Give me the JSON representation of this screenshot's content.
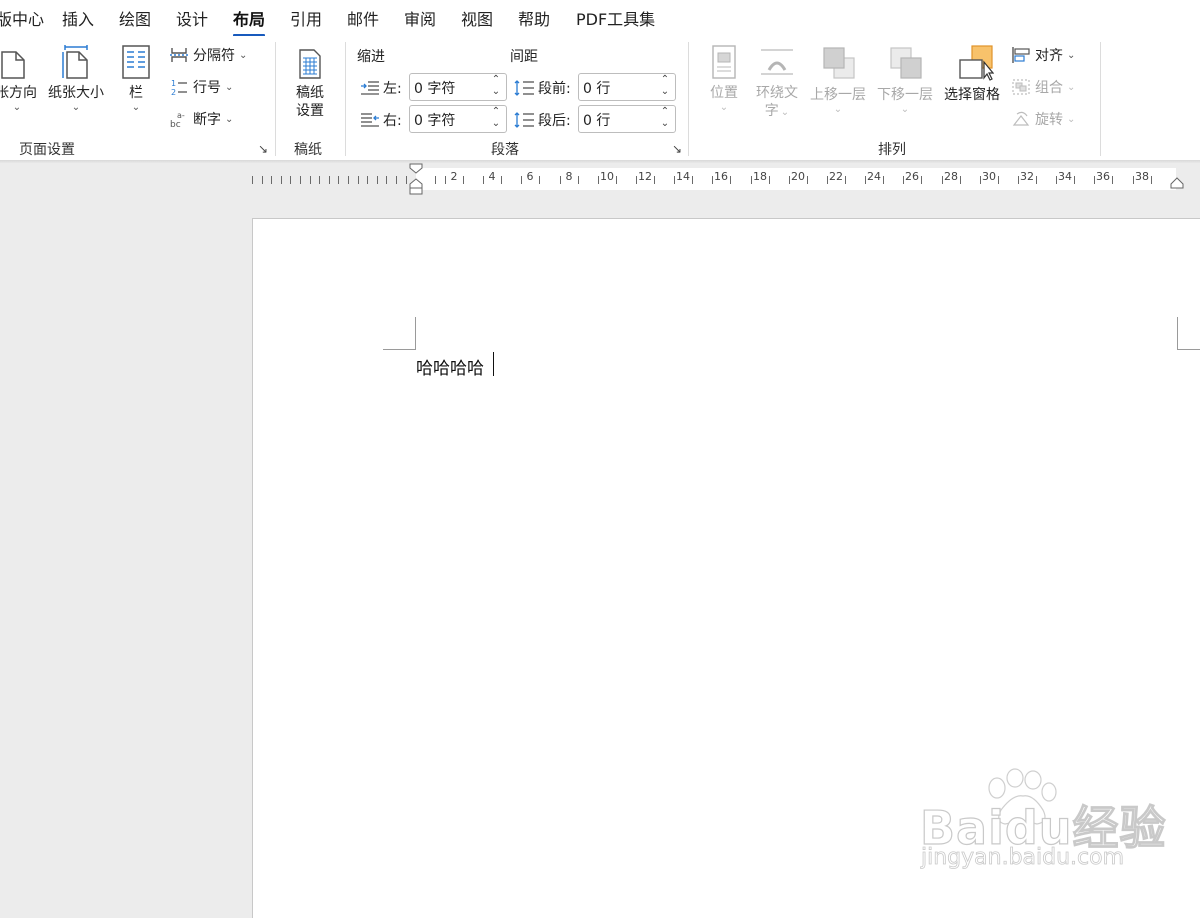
{
  "tabs": [
    {
      "label": "版中心"
    },
    {
      "label": "插入"
    },
    {
      "label": "绘图"
    },
    {
      "label": "设计"
    },
    {
      "label": "布局",
      "active": true
    },
    {
      "label": "引用"
    },
    {
      "label": "邮件"
    },
    {
      "label": "审阅"
    },
    {
      "label": "视图"
    },
    {
      "label": "帮助"
    },
    {
      "label": "PDF工具集"
    }
  ],
  "page_setup": {
    "orientation": "张方向",
    "size": "纸张大小",
    "columns": "栏",
    "breaks": "分隔符",
    "line_numbers": "行号",
    "hyphenation": "断字",
    "group_label": "页面设置"
  },
  "manuscript": {
    "button": "稿纸设置",
    "button_line1": "稿纸",
    "button_line2": "设置",
    "group_label": "稿纸"
  },
  "paragraph": {
    "indent_header": "缩进",
    "spacing_header": "间距",
    "left_label": "左:",
    "left_value": "0 字符",
    "right_label": "右:",
    "right_value": "0 字符",
    "before_label": "段前:",
    "before_value": "0 行",
    "after_label": "段后:",
    "after_value": "0 行",
    "group_label": "段落"
  },
  "arrange": {
    "position": "位置",
    "wrap_line1": "环绕文",
    "wrap_line2": "字",
    "bring_forward": "上移一层",
    "send_backward": "下移一层",
    "selection_pane": "选择窗格",
    "align": "对齐",
    "group": "组合",
    "rotate": "旋转",
    "group_label": "排列"
  },
  "ruler": {
    "numbers": [
      "2",
      "4",
      "6",
      "8",
      "10",
      "12",
      "14",
      "16",
      "18",
      "20",
      "22",
      "24",
      "26",
      "28",
      "30",
      "32",
      "34",
      "36",
      "38"
    ]
  },
  "document": {
    "text": "哈哈哈哈"
  },
  "watermark": {
    "logo": "Baidu经验",
    "url": "jingyan.baidu.com"
  },
  "colors": {
    "active_tab_underline": "#185abd",
    "selection_pane_icon": "#f5a623"
  }
}
